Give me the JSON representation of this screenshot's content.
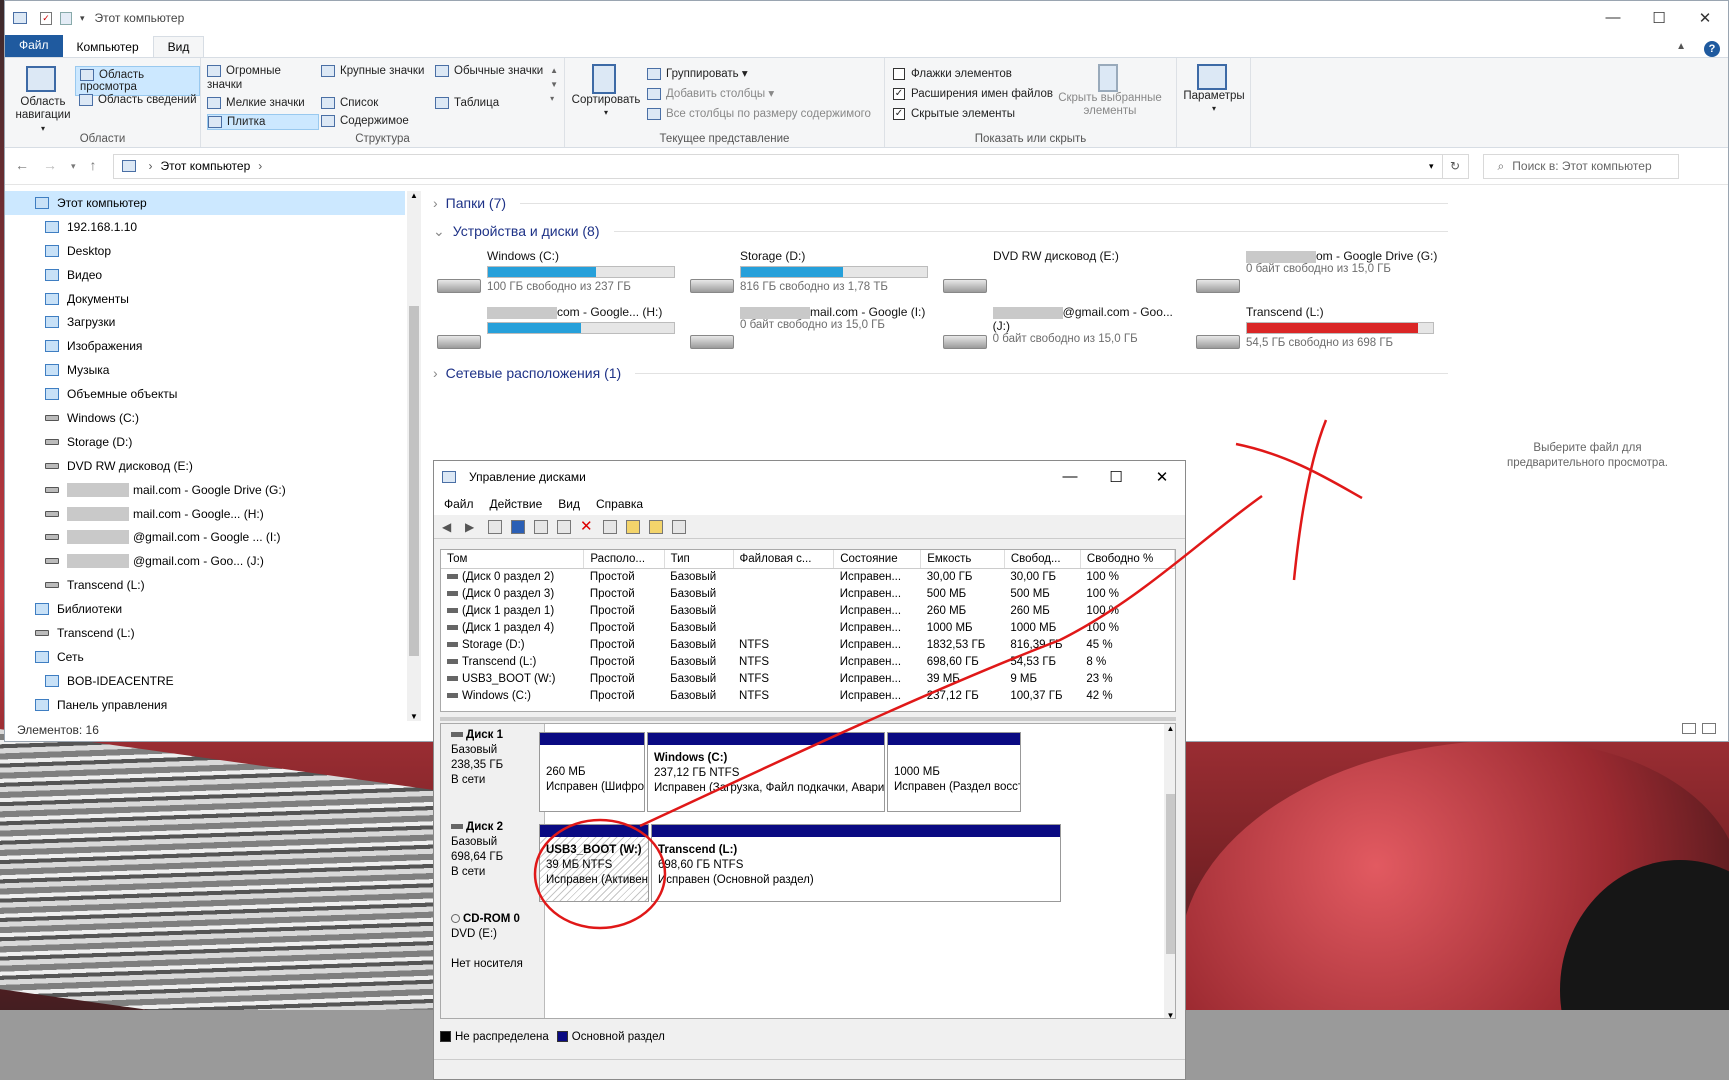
{
  "explorer": {
    "title": "Этот компьютер",
    "tabs": [
      "Файл",
      "Компьютер",
      "Вид"
    ],
    "ribbon": {
      "areas": {
        "nav_pane": "Область навигации",
        "preview": "Область просмотра",
        "details": "Область сведений",
        "group": "Области"
      },
      "structure": {
        "items": [
          "Огромные значки",
          "Крупные значки",
          "Обычные значки",
          "Мелкие значки",
          "Список",
          "Таблица",
          "Плитка",
          "Содержимое"
        ],
        "group": "Структура"
      },
      "current": {
        "sort": "Сортировать",
        "group_by": "Группировать",
        "add_cols": "Добавить столбцы",
        "fit_cols": "Все столбцы по размеру содержимого",
        "group": "Текущее представление"
      },
      "show": {
        "item_checkboxes": "Флажки элементов",
        "extensions": "Расширения имен файлов",
        "hidden": "Скрытые элементы",
        "hide_selected": "Скрыть выбранные элементы",
        "group": "Показать или скрыть"
      },
      "options": "Параметры"
    },
    "address": "Этот компьютер",
    "search_placeholder": "Поиск в: Этот компьютер",
    "nav": [
      {
        "label": "Этот компьютер",
        "level": 0
      },
      {
        "label": "192.168.1.10",
        "level": 1
      },
      {
        "label": "Desktop",
        "level": 1
      },
      {
        "label": "Видео",
        "level": 1
      },
      {
        "label": "Документы",
        "level": 1
      },
      {
        "label": "Загрузки",
        "level": 1
      },
      {
        "label": "Изображения",
        "level": 1
      },
      {
        "label": "Музыка",
        "level": 1
      },
      {
        "label": "Объемные объекты",
        "level": 1
      },
      {
        "label": "Windows (C:)",
        "level": 1
      },
      {
        "label": "Storage (D:)",
        "level": 1
      },
      {
        "label": "DVD RW дисковод (E:)",
        "level": 1
      },
      {
        "label": "mail.com - Google Drive (G:)",
        "level": 1
      },
      {
        "label": "mail.com - Google... (H:)",
        "level": 1
      },
      {
        "label": "@gmail.com - Google ... (I:)",
        "level": 1
      },
      {
        "label": "@gmail.com - Goo... (J:)",
        "level": 1
      },
      {
        "label": "Transcend (L:)",
        "level": 1
      },
      {
        "label": "Библиотеки",
        "level": 0
      },
      {
        "label": "Transcend (L:)",
        "level": 0
      },
      {
        "label": "Сеть",
        "level": 0
      },
      {
        "label": "BOB-IDEACENTRE",
        "level": 1
      },
      {
        "label": "Панель управления",
        "level": 0
      }
    ],
    "sections": {
      "folders": "Папки (7)",
      "devices": "Устройства и диски (8)",
      "network": "Сетевые расположения (1)"
    },
    "drives": [
      {
        "name": "Windows (C:)",
        "sub": "100 ГБ свободно из 237 ГБ",
        "used": 0.58,
        "bar": true,
        "color": "#26a0da"
      },
      {
        "name": "Storage (D:)",
        "sub": "816 ГБ свободно из 1,78 ТБ",
        "used": 0.55,
        "bar": true,
        "color": "#26a0da"
      },
      {
        "name": "DVD RW дисковод (E:)",
        "sub": "",
        "used": 0,
        "bar": false,
        "color": ""
      },
      {
        "name": "om - Google Drive (G:)",
        "sub": "0 байт свободно из 15,0 ГБ",
        "used": 1.0,
        "bar": false,
        "color": ""
      },
      {
        "name": "com - Google... (H:)",
        "sub": "",
        "used": 0.5,
        "bar": true,
        "color": "#26a0da"
      },
      {
        "name": "mail.com - Google (I:)",
        "sub": "0 байт свободно из 15,0 ГБ",
        "used": 1.0,
        "bar": false,
        "color": ""
      },
      {
        "name": "@gmail.com - Goo... (J:)",
        "sub": "0 байт свободно из 15,0 ГБ",
        "used": 1.0,
        "bar": false,
        "color": ""
      },
      {
        "name": "Transcend (L:)",
        "sub": "54,5 ГБ свободно из 698 ГБ",
        "used": 0.92,
        "bar": true,
        "color": "#da2626"
      }
    ],
    "preview_text": "Выберите файл для предварительного просмотра.",
    "status": "Элементов: 16"
  },
  "diskmgmt": {
    "title": "Управление дисками",
    "menu": [
      "Файл",
      "Действие",
      "Вид",
      "Справка"
    ],
    "columns": [
      "Том",
      "Располо...",
      "Тип",
      "Файловая с...",
      "Состояние",
      "Емкость",
      "Свобод...",
      "Свободно %"
    ],
    "rows": [
      [
        "(Диск 0 раздел 2)",
        "Простой",
        "Базовый",
        "",
        "Исправен...",
        "30,00 ГБ",
        "30,00 ГБ",
        "100 %"
      ],
      [
        "(Диск 0 раздел 3)",
        "Простой",
        "Базовый",
        "",
        "Исправен...",
        "500 МБ",
        "500 МБ",
        "100 %"
      ],
      [
        "(Диск 1 раздел 1)",
        "Простой",
        "Базовый",
        "",
        "Исправен...",
        "260 МБ",
        "260 МБ",
        "100 %"
      ],
      [
        "(Диск 1 раздел 4)",
        "Простой",
        "Базовый",
        "",
        "Исправен...",
        "1000 МБ",
        "1000 МБ",
        "100 %"
      ],
      [
        "Storage (D:)",
        "Простой",
        "Базовый",
        "NTFS",
        "Исправен...",
        "1832,53 ГБ",
        "816,39 ГБ",
        "45 %"
      ],
      [
        "Transcend (L:)",
        "Простой",
        "Базовый",
        "NTFS",
        "Исправен...",
        "698,60 ГБ",
        "54,53 ГБ",
        "8 %"
      ],
      [
        "USB3_BOOT (W:)",
        "Простой",
        "Базовый",
        "NTFS",
        "Исправен...",
        "39 МБ",
        "9 МБ",
        "23 %"
      ],
      [
        "Windows (C:)",
        "Простой",
        "Базовый",
        "NTFS",
        "Исправен...",
        "237,12 ГБ",
        "100,37 ГБ",
        "42 %"
      ]
    ],
    "disk1": {
      "name": "Диск 1",
      "type": "Базовый",
      "size": "238,35 ГБ",
      "status": "В сети",
      "parts": [
        {
          "title": "",
          "line1": "260 МБ",
          "line2": "Исправен (Шифро"
        },
        {
          "title": "Windows  (C:)",
          "line1": "237,12 ГБ NTFS",
          "line2": "Исправен (Загрузка, Файл подкачки, Аварий"
        },
        {
          "title": "",
          "line1": "1000 МБ",
          "line2": "Исправен (Раздел восст"
        }
      ]
    },
    "disk2": {
      "name": "Диск 2",
      "type": "Базовый",
      "size": "698,64 ГБ",
      "status": "В сети",
      "parts": [
        {
          "title": "USB3_BOOT  (W:)",
          "line1": "39 МБ NTFS",
          "line2": "Исправен (Активен,"
        },
        {
          "title": "Transcend  (L:)",
          "line1": "698,60 ГБ NTFS",
          "line2": "Исправен (Основной раздел)"
        }
      ]
    },
    "cdrom": {
      "name": "CD-ROM 0",
      "type": "DVD (E:)",
      "status": "Нет носителя"
    },
    "legend": [
      "Не распределена",
      "Основной раздел"
    ],
    "colors": {
      "unallocated": "#000000",
      "primary": "#0a0a82"
    }
  }
}
